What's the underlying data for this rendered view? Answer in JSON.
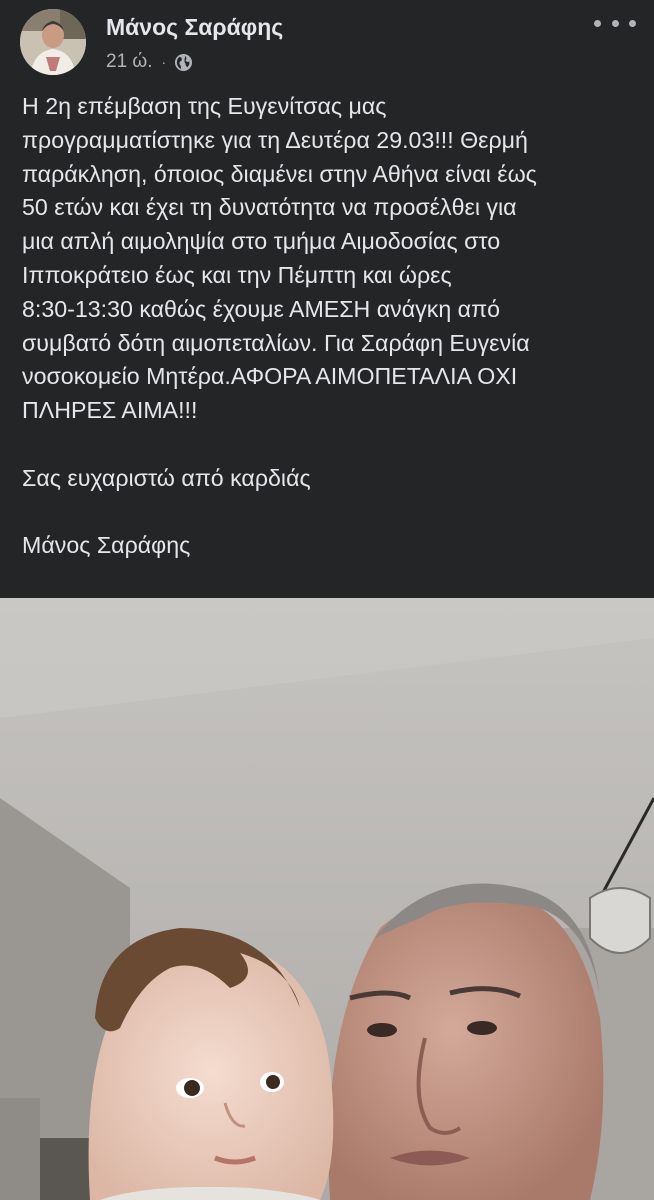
{
  "post": {
    "author": "Μάνος Σαράφης",
    "time": "21 ώ.",
    "separator": "·",
    "audience_icon": "globe-icon",
    "more_icon": "more-options-icon",
    "paragraphs": [
      "Η 2η επέμβαση της Ευγενίτσας μας\nπρογραμματίστηκε για τη Δευτέρα 29.03!!! Θερμή\nπαράκληση, όποιος διαμένει στην Αθήνα είναι έως\n50 ετών και έχει τη δυνατότητα να προσέλθει για\nμια απλή αιμοληψία στο τμήμα Αιμοδοσίας στο\nΙπποκράτειο έως και την Πέμπτη και ώρες\n8:30-13:30 καθώς έχουμε ΑΜΕΣΗ ανάγκη από\nσυμβατό δότη αιμοπεταλίων. Για Σαράφη Ευγενία\nνοσοκομείο Μητέρα.ΑΦΟΡΑ ΑΙΜΟΠΕΤΑΛΙΑ ΟΧΙ\nΠΛΗΡΕΣ ΑΙΜΑ!!!",
      "Σας ευχαριστώ από καρδιάς",
      "Μάνος Σαράφης"
    ]
  },
  "colors": {
    "background": "#242526",
    "primary_text": "#e4e6eb",
    "secondary_text": "#b0b3b8"
  }
}
